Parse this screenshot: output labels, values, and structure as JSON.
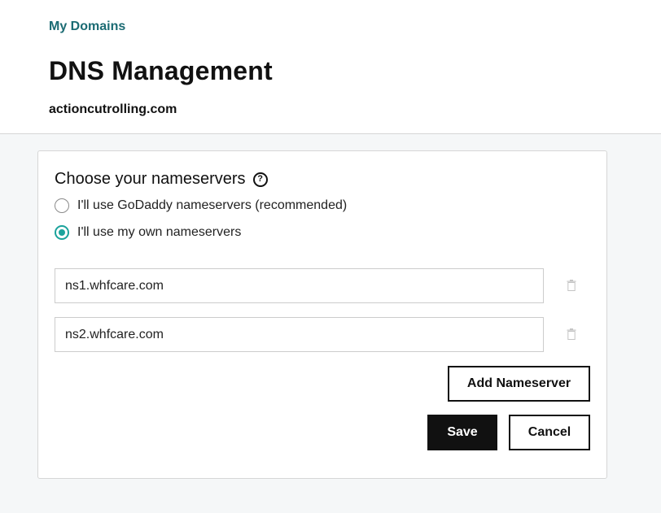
{
  "header": {
    "breadcrumb": "My Domains",
    "title": "DNS Management",
    "domain": "actioncutrolling.com"
  },
  "nameservers": {
    "section_title": "Choose your nameservers",
    "help_icon": "question-circle-icon",
    "options": [
      {
        "label": "I'll use GoDaddy nameservers (recommended)",
        "selected": false
      },
      {
        "label": "I'll use my own nameservers",
        "selected": true
      }
    ],
    "entries": [
      {
        "value": "ns1.whfcare.com",
        "delete_icon": "trash-icon"
      },
      {
        "value": "ns2.whfcare.com",
        "delete_icon": "trash-icon"
      }
    ],
    "add_label": "Add Nameserver",
    "save_label": "Save",
    "cancel_label": "Cancel"
  },
  "colors": {
    "accent": "#1ba39c",
    "link": "#1b6b73",
    "primary_button": "#111111",
    "background": "#f5f7f8"
  }
}
